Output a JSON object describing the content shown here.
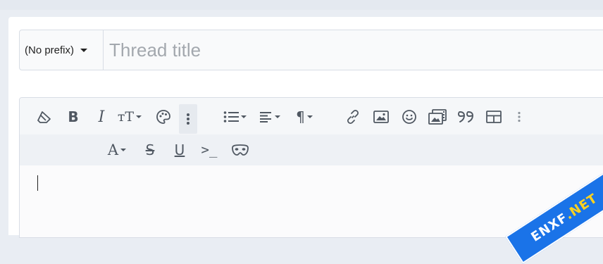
{
  "thread": {
    "prefix_label": "(No prefix)",
    "title_placeholder": "Thread title",
    "title_value": ""
  },
  "toolbar": {
    "row1": [
      {
        "name": "remove-format-icon",
        "tooltip": "Remove formatting"
      },
      {
        "name": "bold-icon",
        "glyph": "B"
      },
      {
        "name": "italic-icon",
        "glyph": "I"
      },
      {
        "name": "font-size-icon",
        "glyph": "тT"
      },
      {
        "name": "text-color-palette-icon"
      },
      {
        "name": "more-options-icon"
      },
      {
        "name": "list-icon"
      },
      {
        "name": "align-icon"
      },
      {
        "name": "paragraph-icon",
        "glyph": "¶"
      },
      {
        "name": "link-icon"
      },
      {
        "name": "image-icon"
      },
      {
        "name": "emoji-icon"
      },
      {
        "name": "media-icon"
      },
      {
        "name": "quote-icon",
        "glyph": "99"
      },
      {
        "name": "table-icon"
      },
      {
        "name": "more-vertical-icon"
      }
    ],
    "row2": [
      {
        "name": "font-family-icon",
        "glyph": "A"
      },
      {
        "name": "strikethrough-icon",
        "glyph": "S"
      },
      {
        "name": "underline-icon",
        "glyph": "U"
      },
      {
        "name": "code-icon",
        "glyph": ">_"
      },
      {
        "name": "spoiler-icon"
      }
    ]
  },
  "watermark": {
    "brand_text_a": "ENXF",
    "brand_text_b": ".NET"
  },
  "colors": {
    "page_bg": "#e9edf3",
    "icon": "#505862",
    "placeholder": "#a3a8ae",
    "border": "#d8dde5"
  }
}
